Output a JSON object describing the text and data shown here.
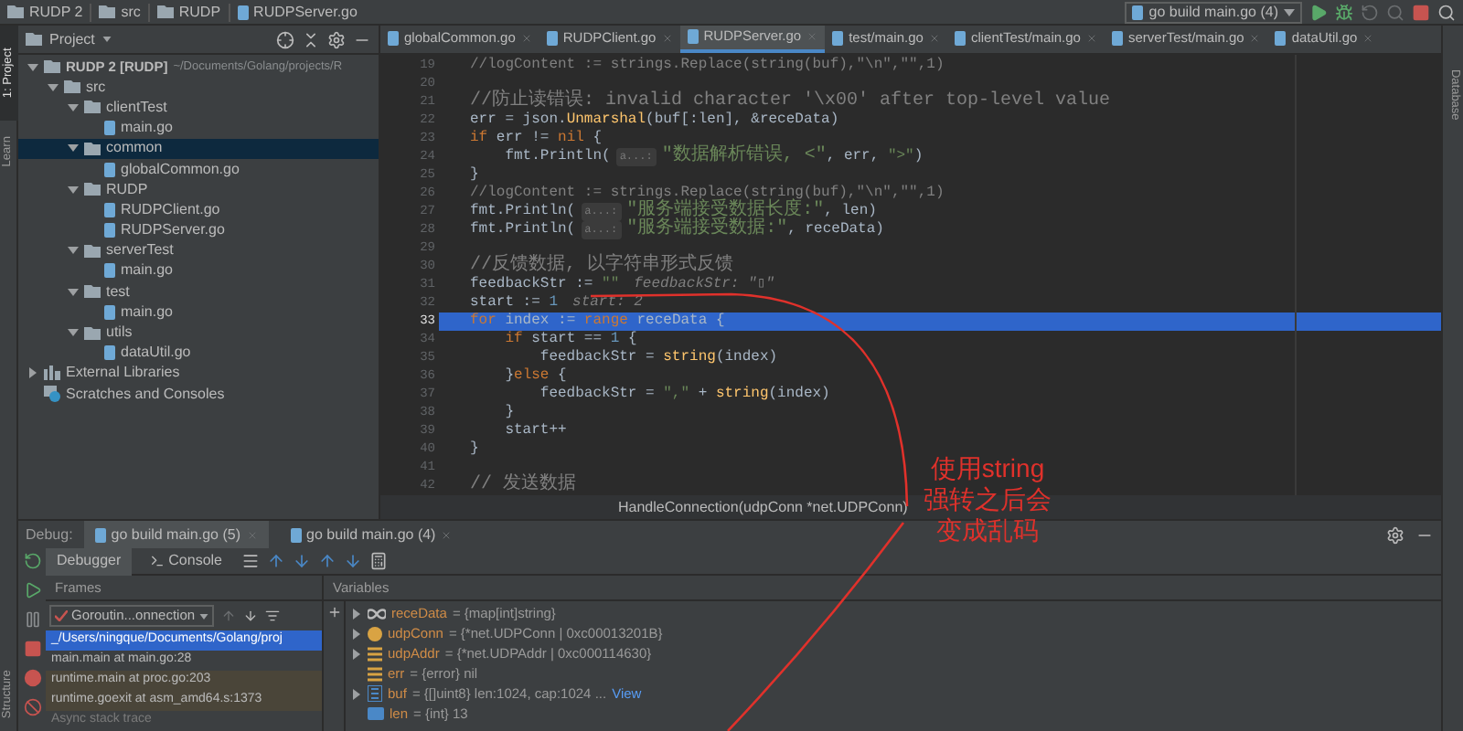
{
  "breadcrumb": [
    {
      "label": "RUDP 2",
      "kind": "folder"
    },
    {
      "label": "src",
      "kind": "folder"
    },
    {
      "label": "RUDP",
      "kind": "folder"
    },
    {
      "label": "RUDPServer.go",
      "kind": "file"
    }
  ],
  "run_config": {
    "label": "go build main.go (4)"
  },
  "left_tool_windows": [
    {
      "label": "1: Project",
      "selected": true
    },
    {
      "label": "Learn",
      "selected": false
    }
  ],
  "structure_tab": {
    "label": "Structure"
  },
  "right_tool_window": {
    "label": "Database"
  },
  "project_panel": {
    "title": "Project",
    "tree": [
      {
        "label": "RUDP 2 [RUDP]",
        "path": "~/Documents/Golang/projects/R",
        "kind": "folder",
        "expanded": true,
        "selected": false,
        "children": [
          {
            "label": "src",
            "kind": "folder",
            "expanded": true,
            "selected": false,
            "children": [
              {
                "label": "clientTest",
                "kind": "folder",
                "expanded": true,
                "selected": false,
                "children": [
                  {
                    "label": "main.go",
                    "kind": "file",
                    "selected": false
                  }
                ]
              },
              {
                "label": "common",
                "kind": "folder",
                "expanded": true,
                "selected": true,
                "children": [
                  {
                    "label": "globalCommon.go",
                    "kind": "file",
                    "selected": false
                  }
                ]
              },
              {
                "label": "RUDP",
                "kind": "folder",
                "expanded": true,
                "selected": false,
                "children": [
                  {
                    "label": "RUDPClient.go",
                    "kind": "file",
                    "selected": false
                  },
                  {
                    "label": "RUDPServer.go",
                    "kind": "file",
                    "selected": false
                  }
                ]
              },
              {
                "label": "serverTest",
                "kind": "folder",
                "expanded": true,
                "selected": false,
                "children": [
                  {
                    "label": "main.go",
                    "kind": "file",
                    "selected": false
                  }
                ]
              },
              {
                "label": "test",
                "kind": "folder",
                "expanded": true,
                "selected": false,
                "children": [
                  {
                    "label": "main.go",
                    "kind": "file",
                    "selected": false
                  }
                ]
              },
              {
                "label": "utils",
                "kind": "folder",
                "expanded": true,
                "selected": false,
                "children": [
                  {
                    "label": "dataUtil.go",
                    "kind": "file",
                    "selected": false
                  }
                ]
              }
            ]
          }
        ]
      },
      {
        "label": "External Libraries",
        "kind": "libraries",
        "expanded": false,
        "selected": false
      },
      {
        "label": "Scratches and Consoles",
        "kind": "scratches",
        "selected": false
      }
    ]
  },
  "editor_tabs": [
    {
      "label": "globalCommon.go",
      "selected": false
    },
    {
      "label": "RUDPClient.go",
      "selected": false
    },
    {
      "label": "RUDPServer.go",
      "selected": true
    },
    {
      "label": "test/main.go",
      "selected": false
    },
    {
      "label": "clientTest/main.go",
      "selected": false
    },
    {
      "label": "serverTest/main.go",
      "selected": false
    },
    {
      "label": "dataUtil.go",
      "selected": false
    }
  ],
  "code": [
    {
      "number": "19",
      "current": false,
      "tokens": [
        {
          "text": "//logContent := strings.Replace(string(buf),\"\\n\",\"\",1)",
          "kind": "comment"
        }
      ]
    },
    {
      "number": "20",
      "current": false
    },
    {
      "number": "21",
      "current": false,
      "tokens": [
        {
          "text": "//防止读错误: invalid character '\\x00' after top-level value",
          "kind": "comment"
        }
      ]
    },
    {
      "number": "22",
      "current": false,
      "tokens": [
        {
          "text": "err = json.",
          "kind": "plain"
        },
        {
          "text": "Unmarshal",
          "kind": "fn"
        },
        {
          "text": "(buf[:len], &receData)",
          "kind": "plain"
        }
      ]
    },
    {
      "number": "23",
      "current": false,
      "tokens": [
        {
          "text": "if",
          "kind": "kw"
        },
        {
          "text": " err != ",
          "kind": "plain"
        },
        {
          "text": "nil",
          "kind": "kw"
        },
        {
          "text": " {",
          "kind": "plain"
        }
      ]
    },
    {
      "number": "24",
      "current": false,
      "tokens": [
        {
          "text": "    fmt.Println(",
          "kind": "plain"
        },
        {
          "text": "a...:",
          "kind": "hint"
        },
        {
          "text": "\"数据解析错误, <\"",
          "kind": "str"
        },
        {
          "text": ", err, ",
          "kind": "plain"
        },
        {
          "text": "\">\"",
          "kind": "str"
        },
        {
          "text": ")",
          "kind": "plain"
        }
      ]
    },
    {
      "number": "25",
      "current": false,
      "tokens": [
        {
          "text": "}",
          "kind": "plain"
        }
      ]
    },
    {
      "number": "26",
      "current": false,
      "tokens": [
        {
          "text": "//logContent := strings.Replace(string(buf),\"\\n\",\"\",1)",
          "kind": "comment"
        }
      ]
    },
    {
      "number": "27",
      "current": false,
      "tokens": [
        {
          "text": "fmt.Println(",
          "kind": "plain"
        },
        {
          "text": "a...:",
          "kind": "hint"
        },
        {
          "text": "\"服务端接受数据长度:\"",
          "kind": "str"
        },
        {
          "text": ", len)",
          "kind": "plain"
        }
      ]
    },
    {
      "number": "28",
      "current": false,
      "tokens": [
        {
          "text": "fmt.Println(",
          "kind": "plain"
        },
        {
          "text": "a...:",
          "kind": "hint"
        },
        {
          "text": "\"服务端接受数据:\"",
          "kind": "str"
        },
        {
          "text": ", receData)",
          "kind": "plain"
        }
      ]
    },
    {
      "number": "29",
      "current": false
    },
    {
      "number": "30",
      "current": false,
      "tokens": [
        {
          "text": "//反馈数据, 以字符串形式反馈",
          "kind": "comment"
        }
      ]
    },
    {
      "number": "31",
      "current": false,
      "tokens": [
        {
          "text": "feedbackStr := ",
          "kind": "plain"
        },
        {
          "text": "\"\"",
          "kind": "str"
        },
        {
          "text": "feedbackStr: \"▯\"",
          "kind": "inline"
        }
      ]
    },
    {
      "number": "32",
      "current": false,
      "tokens": [
        {
          "text": "start := ",
          "kind": "plain"
        },
        {
          "text": "1",
          "kind": "num"
        },
        {
          "text": "start: 2",
          "kind": "inline"
        }
      ]
    },
    {
      "number": "33",
      "current": true,
      "tokens": [
        {
          "text": "for",
          "kind": "kw"
        },
        {
          "text": " index := ",
          "kind": "plain"
        },
        {
          "text": "range",
          "kind": "kw"
        },
        {
          "text": " receData {",
          "kind": "plain"
        }
      ]
    },
    {
      "number": "34",
      "current": false,
      "tokens": [
        {
          "text": "    if",
          "kind": "kw"
        },
        {
          "text": " start == ",
          "kind": "plain"
        },
        {
          "text": "1",
          "kind": "num"
        },
        {
          "text": " {",
          "kind": "plain"
        }
      ]
    },
    {
      "number": "35",
      "current": false,
      "tokens": [
        {
          "text": "        feedbackStr = ",
          "kind": "plain"
        },
        {
          "text": "string",
          "kind": "fn"
        },
        {
          "text": "(index)",
          "kind": "plain"
        }
      ]
    },
    {
      "number": "36",
      "current": false,
      "tokens": [
        {
          "text": "    }",
          "kind": "plain"
        },
        {
          "text": "else",
          "kind": "kw"
        },
        {
          "text": " {",
          "kind": "plain"
        }
      ]
    },
    {
      "number": "37",
      "current": false,
      "tokens": [
        {
          "text": "        feedbackStr = ",
          "kind": "plain"
        },
        {
          "text": "\",\"",
          "kind": "str"
        },
        {
          "text": " + ",
          "kind": "plain"
        },
        {
          "text": "string",
          "kind": "fn"
        },
        {
          "text": "(index)",
          "kind": "plain"
        }
      ]
    },
    {
      "number": "38",
      "current": false,
      "tokens": [
        {
          "text": "    }",
          "kind": "plain"
        }
      ]
    },
    {
      "number": "39",
      "current": false,
      "tokens": [
        {
          "text": "    start++",
          "kind": "plain"
        }
      ]
    },
    {
      "number": "40",
      "current": false,
      "tokens": [
        {
          "text": "}",
          "kind": "plain"
        }
      ]
    },
    {
      "number": "41",
      "current": false
    },
    {
      "number": "42",
      "current": false,
      "tokens": [
        {
          "text": "// 发送数据",
          "kind": "comment"
        }
      ]
    }
  ],
  "editor_breadcrumb": "HandleConnection(udpConn *net.UDPConn)",
  "debug": {
    "label": "Debug:",
    "tabs": [
      {
        "label": "go build main.go (5)",
        "selected": true
      },
      {
        "label": "go build main.go (4)",
        "selected": false
      }
    ],
    "subtabs": [
      {
        "label": "Debugger",
        "selected": true,
        "kind": "debugger"
      },
      {
        "label": "Console",
        "selected": false,
        "kind": "console"
      }
    ],
    "frames": {
      "title": "Frames",
      "thread": "Goroutin...onnection",
      "items": [
        {
          "label": "_/Users/ningque/Documents/Golang/proj",
          "selected": true,
          "kind": "user"
        },
        {
          "label": "main.main at main.go:28",
          "selected": false,
          "kind": "user"
        },
        {
          "label": "runtime.main at proc.go:203",
          "selected": false,
          "kind": "library"
        },
        {
          "label": "runtime.goexit at asm_amd64.s:1373",
          "selected": false,
          "kind": "library"
        },
        {
          "label": "Async stack trace",
          "selected": false,
          "kind": "separator"
        }
      ]
    },
    "variables": {
      "title": "Variables",
      "items": [
        {
          "name": "receData",
          "value": "= {map[int]string}",
          "expandable": true,
          "kind": "map"
        },
        {
          "name": "udpConn",
          "value": "= {*net.UDPConn | 0xc00013201B}",
          "expandable": true,
          "kind": "pointer"
        },
        {
          "name": "udpAddr",
          "value": "= {*net.UDPAddr | 0xc000114630}",
          "expandable": true,
          "kind": "struct"
        },
        {
          "name": "err",
          "value": "= {error} nil",
          "expandable": false,
          "kind": "struct"
        },
        {
          "name": "buf",
          "value": "= {[]uint8} len:1024, cap:1024 ...",
          "link": "View",
          "expandable": true,
          "kind": "slice"
        },
        {
          "name": "len",
          "value": "= {int} 13",
          "expandable": false,
          "kind": "int"
        }
      ]
    }
  },
  "annotation": {
    "lines": [
      "使用string",
      "强转之后会",
      "变成乱码"
    ]
  }
}
